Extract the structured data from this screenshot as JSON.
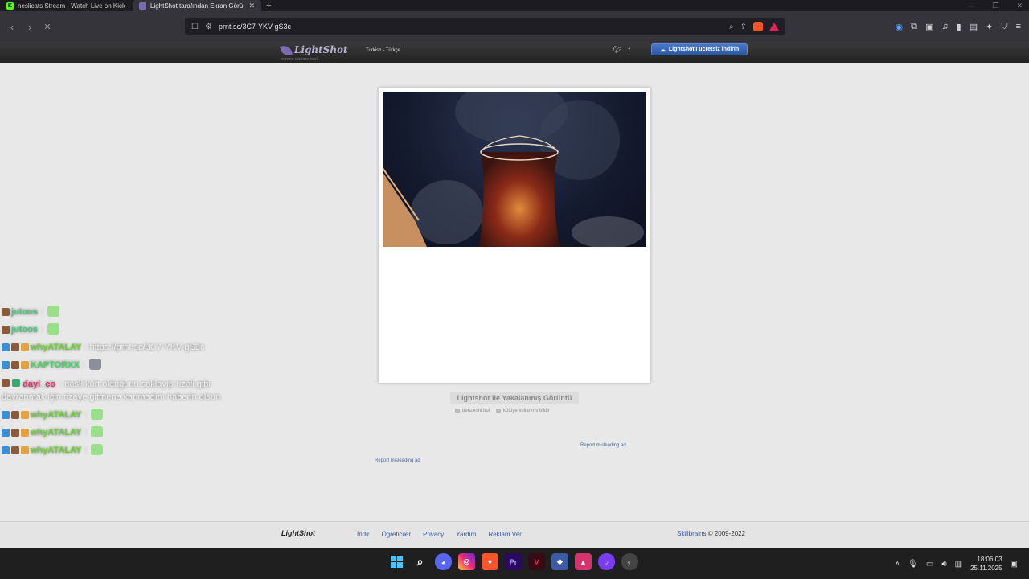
{
  "browser": {
    "tabs": [
      {
        "title": "neslicats Stream - Watch Live on Kick",
        "favicon": "kick-icon"
      },
      {
        "title": "LightShot tarafından Ekran Görü",
        "favicon": "lightshot-icon",
        "active": true
      }
    ],
    "url": "prnt.sc/3C7-YKV-gS3c"
  },
  "lightshot": {
    "logo": "LightShot",
    "logo_tagline": "screen capture tool",
    "language": "Turkish - Türkçe",
    "download_button": "Lightshot'ı ücretsiz indirin",
    "caption": "Lightshot ile Yakalanmış Görüntü",
    "find_similar": "benzerini bul",
    "report_abuse": "kötüye kullanımı bildir",
    "report_ad_1": "Report misleading ad",
    "report_ad_2": "Report misleading ad"
  },
  "footer": {
    "logo": "LightShot",
    "links": [
      "İndir",
      "Öğreticiler",
      "Privacy",
      "Yardım",
      "Reklam Ver"
    ],
    "company": "Skillbrains",
    "copyright": "© 2009-2022"
  },
  "chat": [
    {
      "user": "jutoos",
      "message": ":",
      "color": "#3ccf7a"
    },
    {
      "user": "jutoos",
      "message": ":",
      "color": "#3ccf7a"
    },
    {
      "user": "whyATALAY",
      "message": ": https://prnt.sc/3C7-YKV-gS3c",
      "color": "#64d82a"
    },
    {
      "user": "KAPTORXX",
      "message": ":",
      "color": "#41d85c"
    },
    {
      "user": "dayi_co",
      "message": ": nesli kürt olduğunu saklayıp rizeli gibi davranmak için rizeye gitmene kanmadım haberin olsun",
      "color": "#e0306a"
    },
    {
      "user": "whyATALAY",
      "message": ":",
      "color": "#64d82a"
    },
    {
      "user": "whyATALAY",
      "message": ":",
      "color": "#64d82a"
    },
    {
      "user": "whyATALAY",
      "message": ":",
      "color": "#64d82a"
    }
  ],
  "taskbar": {
    "time": "18:06:03",
    "date": "25.11.2025"
  }
}
